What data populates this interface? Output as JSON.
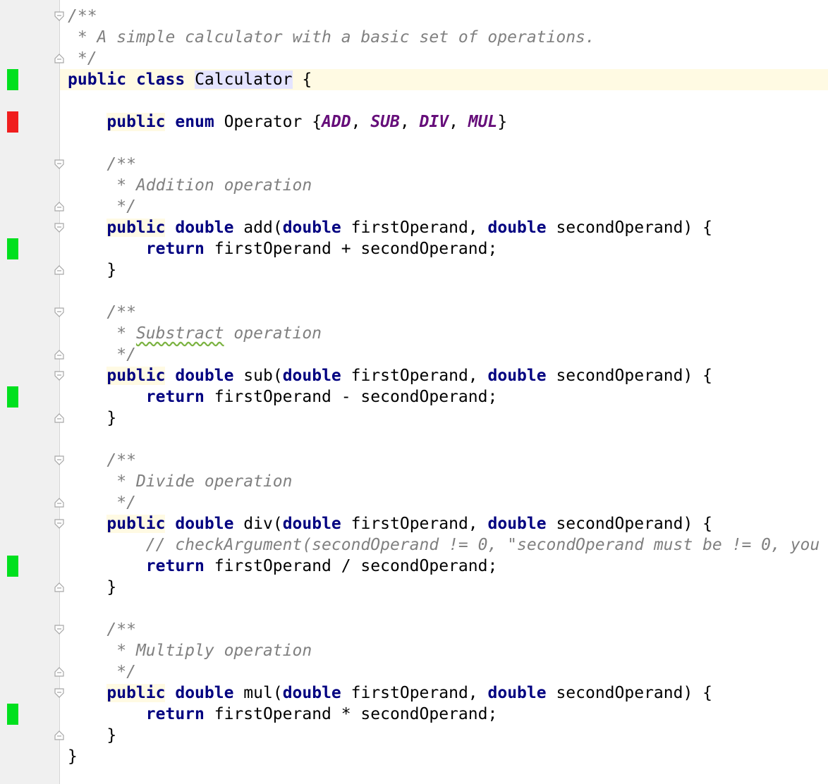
{
  "colors": {
    "keyword": "#000080",
    "comment": "#808080",
    "constant": "#660e7a",
    "coverage_covered": "#00e01e",
    "coverage_uncovered": "#f01e1e",
    "current_line": "#fffae3",
    "identifier_highlight": "#e4e4ff"
  },
  "code": {
    "class_doc": {
      "open": "/**",
      "text": " * A simple calculator with a basic set of operations.",
      "close": " */"
    },
    "class_decl": {
      "kw_public": "public",
      "kw_class": "class",
      "name": "Calculator",
      "brace": " {"
    },
    "enum_decl": {
      "kw_public": "public",
      "kw_enum": "enum",
      "name": " Operator {",
      "values": [
        "ADD",
        "SUB",
        "DIV",
        "MUL"
      ],
      "close": "}"
    },
    "methods": [
      {
        "doc_open": "/**",
        "doc_prefix": " * ",
        "doc_word": "Addition",
        "doc_rest": " operation",
        "doc_close": " */",
        "kw_public": "public",
        "kw_double": "double",
        "name": " add(",
        "param_type1": "double",
        "param_name1": " firstOperand, ",
        "param_type2": "double",
        "param_name2": " secondOperand) {",
        "kw_return": "return",
        "expr": " firstOperand + secondOperand;",
        "close": "}"
      },
      {
        "doc_open": "/**",
        "doc_prefix": " * ",
        "doc_word": "Substract",
        "doc_rest": " operation",
        "doc_close": " */",
        "kw_public": "public",
        "kw_double": "double",
        "name": " sub(",
        "param_type1": "double",
        "param_name1": " firstOperand, ",
        "param_type2": "double",
        "param_name2": " secondOperand) {",
        "kw_return": "return",
        "expr": " firstOperand - secondOperand;",
        "close": "}"
      },
      {
        "doc_open": "/**",
        "doc_prefix": " * ",
        "doc_word": "Divide",
        "doc_rest": " operation",
        "doc_close": " */",
        "kw_public": "public",
        "kw_double": "double",
        "name": " div(",
        "param_type1": "double",
        "param_name1": " firstOperand, ",
        "param_type2": "double",
        "param_name2": " secondOperand) {",
        "line_comment": "// checkArgument(secondOperand != 0, \"secondOperand must be != 0, you",
        "kw_return": "return",
        "expr": " firstOperand / secondOperand;",
        "close": "}"
      },
      {
        "doc_open": "/**",
        "doc_prefix": " * ",
        "doc_word": "Multiply",
        "doc_rest": " operation",
        "doc_close": " */",
        "kw_public": "public",
        "kw_double": "double",
        "name": " mul(",
        "param_type1": "double",
        "param_name1": " firstOperand, ",
        "param_type2": "double",
        "param_name2": " secondOperand) {",
        "kw_return": "return",
        "expr": " firstOperand * secondOperand;",
        "close": "}"
      }
    ],
    "class_close": "}"
  }
}
